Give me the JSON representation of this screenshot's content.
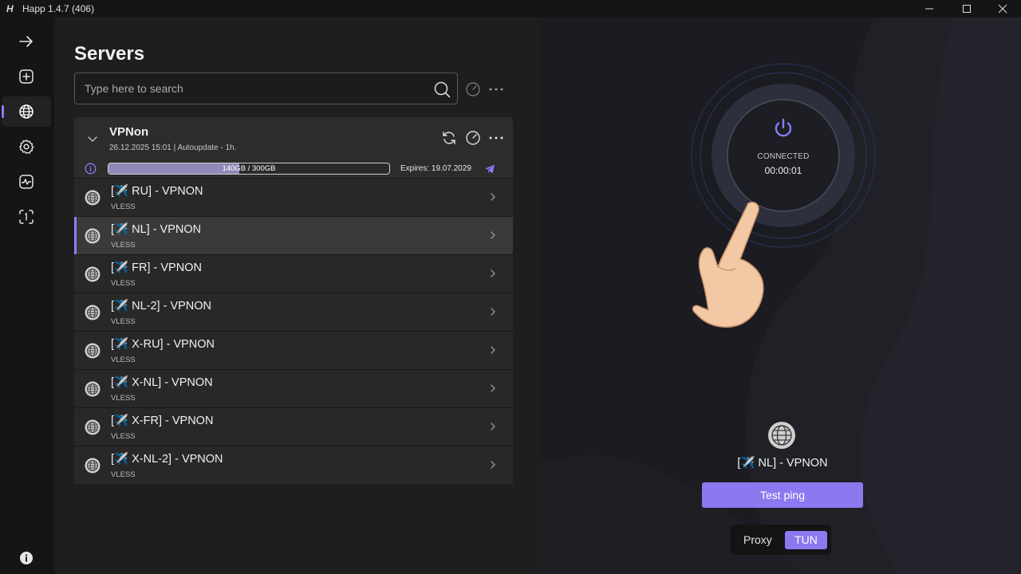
{
  "window": {
    "title": "Happ 1.4.7 (406)",
    "logo": "H"
  },
  "sidebar": {
    "items": [
      {
        "icon": "arrow-right-icon"
      },
      {
        "icon": "add-square-icon"
      },
      {
        "icon": "globe-icon",
        "active": true
      },
      {
        "icon": "gear-icon"
      },
      {
        "icon": "activity-icon"
      },
      {
        "icon": "scan-icon"
      }
    ],
    "bottom_icon": "info-icon"
  },
  "servers": {
    "title": "Servers",
    "search_placeholder": "Type here to search"
  },
  "group": {
    "name": "VPNon",
    "subtitle": "26.12.2025 15:01 | Autoupdate - 1h.",
    "traffic": "140GB / 300GB",
    "traffic_used_fraction": 0.4667,
    "expires": "Expires: 19.07.2029"
  },
  "server_list": [
    {
      "name": "[✈️ RU] - VPNON",
      "protocol": "VLESS"
    },
    {
      "name": "[✈️ NL] - VPNON",
      "protocol": "VLESS",
      "selected": true
    },
    {
      "name": "[✈️ FR] - VPNON",
      "protocol": "VLESS"
    },
    {
      "name": "[✈️ NL-2] - VPNON",
      "protocol": "VLESS"
    },
    {
      "name": "[✈️ X-RU] - VPNON",
      "protocol": "VLESS"
    },
    {
      "name": "[✈️ X-NL] - VPNON",
      "protocol": "VLESS"
    },
    {
      "name": "[✈️ X-FR] - VPNON",
      "protocol": "VLESS"
    },
    {
      "name": "[✈️ X-NL-2] - VPNON",
      "protocol": "VLESS"
    }
  ],
  "connection": {
    "status": "CONNECTED",
    "elapsed": "00:00:01",
    "current_server": "[✈️ NL] - VPNON",
    "test_ping_label": "Test ping",
    "mode_proxy": "Proxy",
    "mode_tun": "TUN",
    "active_mode": "TUN"
  },
  "colors": {
    "accent": "#8c78ef",
    "background": "#1e1e1e"
  }
}
